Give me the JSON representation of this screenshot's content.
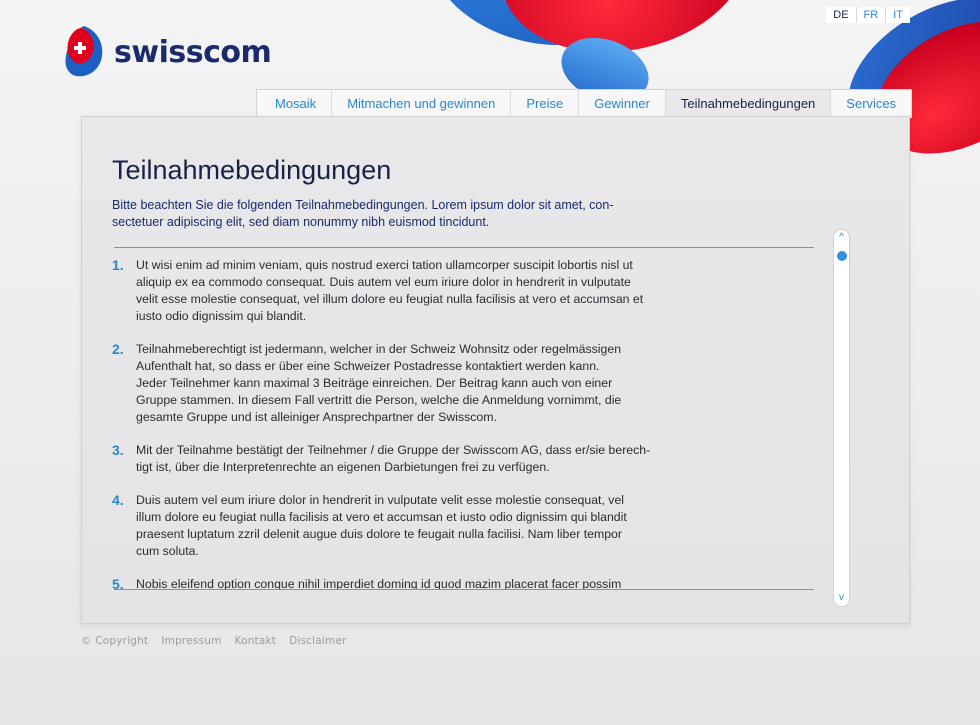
{
  "brand": {
    "name": "swisscom"
  },
  "languages": [
    "DE",
    "FR",
    "IT"
  ],
  "tabs": [
    {
      "label": "Mosaik"
    },
    {
      "label": "Mitmachen und gewinnen"
    },
    {
      "label": "Preise"
    },
    {
      "label": "Gewinner"
    },
    {
      "label": "Teilnahmebedingungen"
    },
    {
      "label": "Services"
    }
  ],
  "content": {
    "title": "Teilnahmebedingungen",
    "intro": "Bitte beachten Sie die folgenden Teilnahmebedingungen. Lorem ipsum dolor sit amet, con-\nsectetuer adipiscing elit, sed diam nonummy nibh euismod tincidunt.",
    "items": [
      {
        "num": "1.",
        "text": "Ut wisi enim ad minim veniam, quis nostrud exerci tation ullamcorper suscipit lobortis nisl ut\naliquip ex ea commodo consequat. Duis autem vel eum iriure dolor in hendrerit in vulputate\nvelit esse molestie consequat, vel illum dolore eu feugiat nulla facilisis at vero et accumsan et\niusto odio dignissim qui blandit."
      },
      {
        "num": "2.",
        "text": "Teilnahmeberechtigt ist jedermann, welcher in der Schweiz Wohnsitz oder regelmässigen\nAufenthalt hat, so dass er über eine Schweizer Postadresse kontaktiert werden kann.\nJeder Teilnehmer kann maximal 3 Beiträge einreichen. Der Beitrag kann auch von einer\nGruppe stammen. In diesem Fall vertritt die Person, welche die Anmeldung vornimmt, die\ngesamte Gruppe und ist alleiniger Ansprechpartner der Swisscom."
      },
      {
        "num": "3.",
        "text": "Mit der Teilnahme bestätigt der Teilnehmer / die Gruppe der Swisscom AG, dass er/sie berech-\ntigt ist, über die Interpretenrechte an eigenen Darbietungen frei zu verfügen."
      },
      {
        "num": "4.",
        "text": "Duis autem vel eum iriure dolor in hendrerit in vulputate velit esse molestie consequat, vel\nillum dolore eu feugiat nulla facilisis at vero et accumsan et iusto odio dignissim qui blandit\npraesent luptatum zzril delenit augue duis dolore te feugait nulla facilisi. Nam liber tempor\ncum soluta."
      },
      {
        "num": "5.",
        "text": "Nobis eleifend option congue nihil imperdiet doming id quod mazim placerat facer possim"
      }
    ]
  },
  "scrollbar": {
    "up": "^",
    "down": "v"
  },
  "footer": [
    "© Copyright",
    "Impressum",
    "Kontakt",
    "Disclaimer"
  ]
}
